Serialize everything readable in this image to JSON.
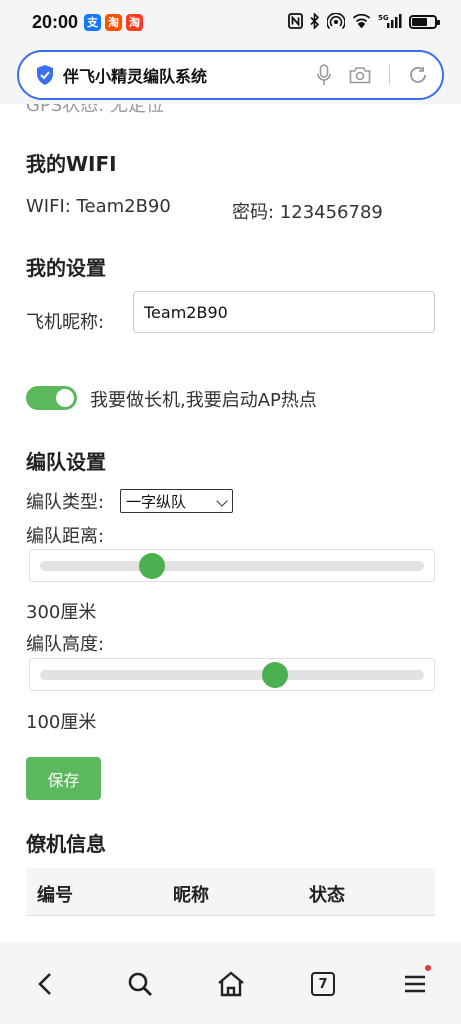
{
  "status_bar": {
    "time": "20:00",
    "app_badges": [
      {
        "label": "支",
        "color": "#1677ff"
      },
      {
        "label": "淘",
        "color": "#ff5000"
      },
      {
        "label": "淘",
        "color": "#ff3c1f"
      }
    ],
    "network": "5G"
  },
  "url_bar": {
    "title": "伴飞小精灵编队系统"
  },
  "page": {
    "clipped_text": "GPS状态: 无定位",
    "wifi": {
      "heading": "我的WIFI",
      "ssid_text": "WIFI: Team2B90",
      "password_text": "密码: 123456789"
    },
    "settings": {
      "heading": "我的设置",
      "nickname_label": "飞机昵称:",
      "nickname_value": "Team2B90",
      "ap_toggle_label": "我要做长机,我要启动AP热点",
      "ap_toggle_on": true
    },
    "formation": {
      "heading": "编队设置",
      "type_label": "编队类型:",
      "type_selected": "一字纵队",
      "distance_label": "编队距离:",
      "distance_value_text": "300厘米",
      "distance_slider_fraction": 0.29,
      "height_label": "编队高度:",
      "height_value_text": "100厘米",
      "height_slider_fraction": 0.61,
      "save_label": "保存"
    },
    "wingman": {
      "heading": "僚机信息",
      "columns": [
        "编号",
        "昵称",
        "状态"
      ]
    }
  },
  "bottom_nav": {
    "tab_count": "7",
    "accent": "#e53935"
  },
  "colors": {
    "primary_green": "#5cb85c",
    "url_border": "#3a6df0"
  }
}
